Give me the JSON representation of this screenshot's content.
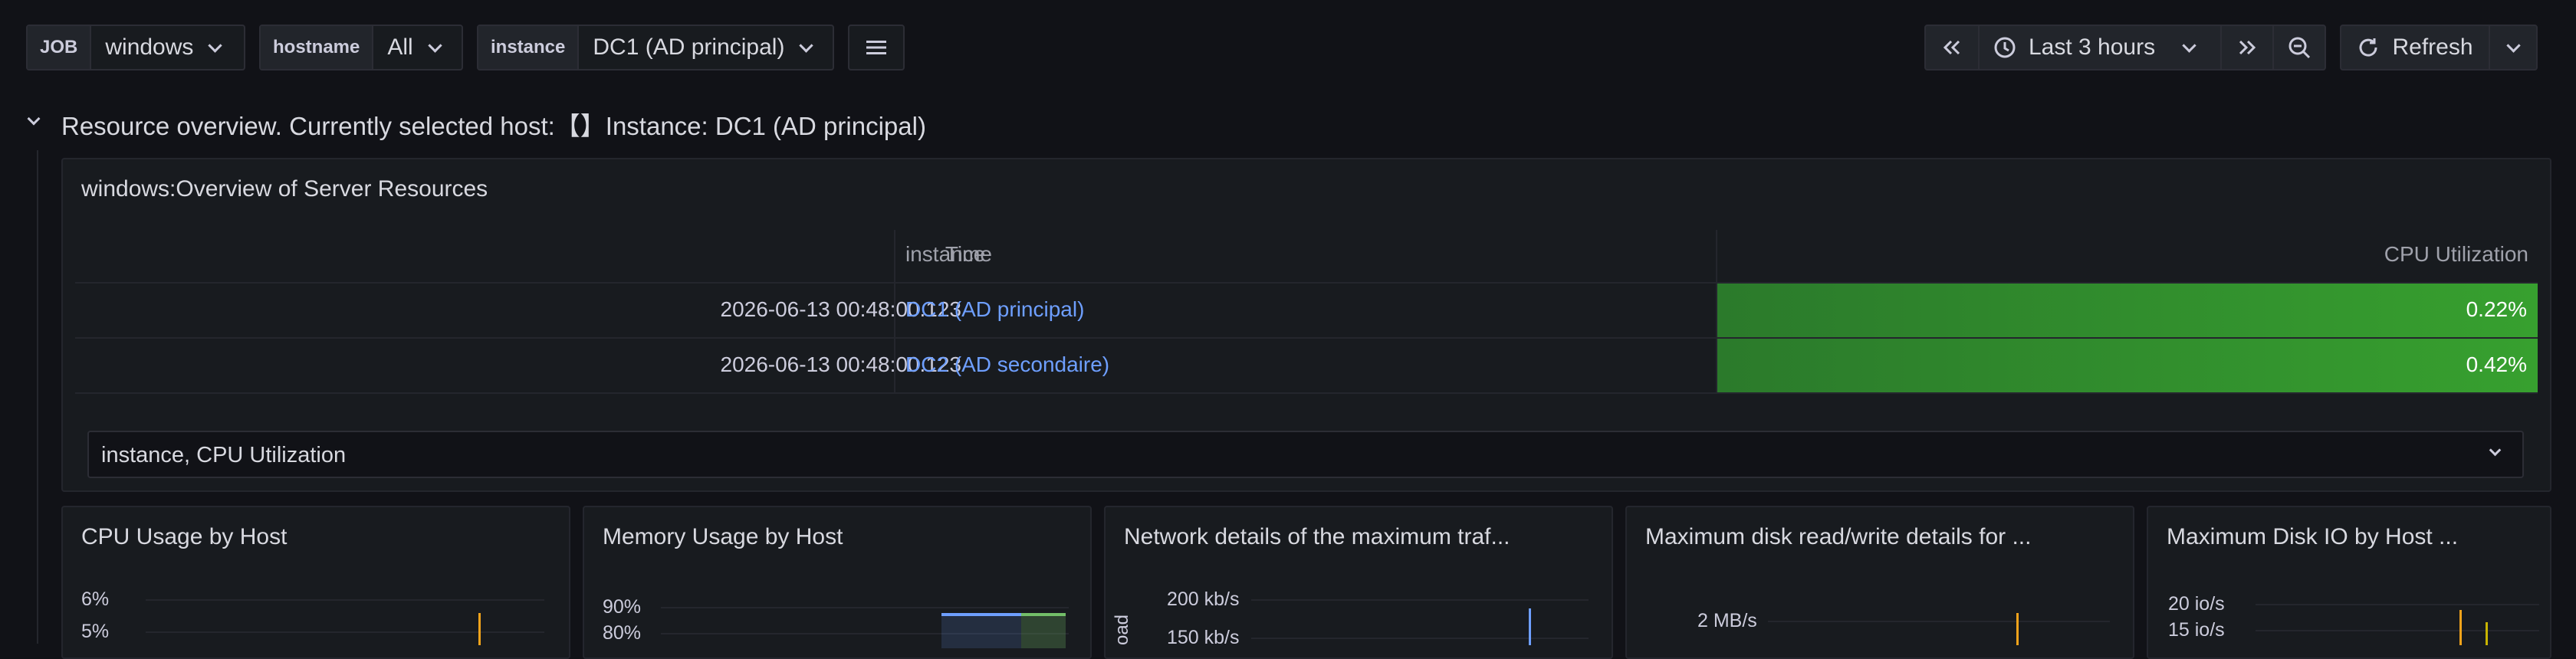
{
  "variables": {
    "job": {
      "label": "JOB",
      "value": "windows"
    },
    "hostname": {
      "label": "hostname",
      "value": "All"
    },
    "instance": {
      "label": "instance",
      "value": "DC1 (AD principal)"
    }
  },
  "time_controls": {
    "range": "Last 3 hours",
    "refresh": "Refresh"
  },
  "row": {
    "title": "Resource overview. Currently selected host:【】Instance: DC1 (AD principal)"
  },
  "table_panel": {
    "title": "windows:Overview of Server Resources",
    "columns": [
      "Time",
      "instance",
      "CPU Utilization"
    ],
    "rows": [
      {
        "time": "2026-06-13 00:48:00.123",
        "instance": "DC1 (AD principal)",
        "cpu": "0.22%"
      },
      {
        "time": "2026-06-13 00:48:00.123",
        "instance": "DC2 (AD secondaire)",
        "cpu": "0.42%"
      }
    ],
    "footer_select": "instance, CPU Utilization"
  },
  "small_panels": [
    {
      "title": "CPU Usage by Host",
      "ticks": [
        "6%",
        "5%"
      ]
    },
    {
      "title": "Memory Usage by Host",
      "ticks": [
        "90%",
        "80%"
      ]
    },
    {
      "title": "Network details of the maximum traf...",
      "ticks": [
        "200 kb/s",
        "150 kb/s"
      ],
      "axis_label": "oad"
    },
    {
      "title": "Maximum disk read/write details for ...",
      "ticks": [
        "2 MB/s"
      ]
    },
    {
      "title": "Maximum Disk IO by Host ...",
      "ticks": [
        "20 io/s",
        "15 io/s"
      ]
    }
  ],
  "colors": {
    "bg": "#111217",
    "panel": "#181b1f",
    "green": "#37872d",
    "link": "#6e9fff"
  }
}
